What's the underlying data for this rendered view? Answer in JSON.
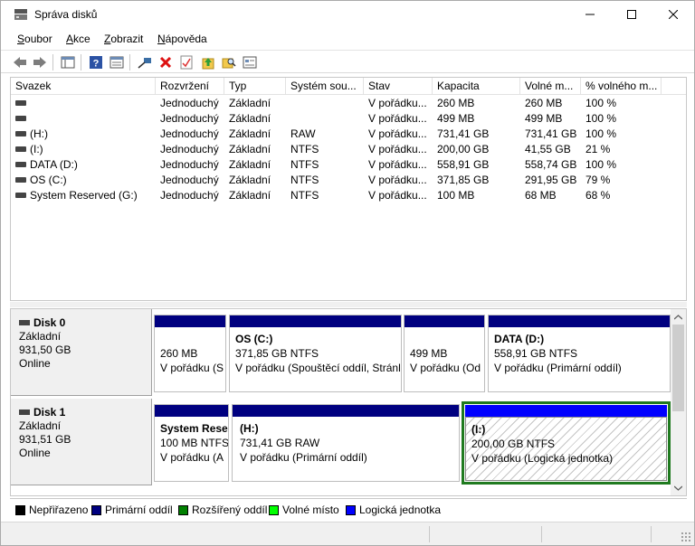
{
  "window": {
    "title": "Správa disků"
  },
  "menu": [
    {
      "label": "Soubor",
      "hot": "S",
      "rest": "oubor"
    },
    {
      "label": "Akce",
      "hot": "A",
      "rest": "kce"
    },
    {
      "label": "Zobrazit",
      "hot": "Z",
      "rest": "obrazit"
    },
    {
      "label": "Nápověda",
      "hot": "N",
      "rest": "ápověda"
    }
  ],
  "volume_list": {
    "columns": [
      "Svazek",
      "Rozvržení",
      "Typ",
      "Systém sou...",
      "Stav",
      "Kapacita",
      "Volné m...",
      "% volného m..."
    ],
    "rows": [
      {
        "svazek": "",
        "rozvrzeni": "Jednoduchý",
        "typ": "Základní",
        "system": "",
        "stav": "V pořádku...",
        "kapacita": "260 MB",
        "volne": "260 MB",
        "procento": "100 %"
      },
      {
        "svazek": "",
        "rozvrzeni": "Jednoduchý",
        "typ": "Základní",
        "system": "",
        "stav": "V pořádku...",
        "kapacita": "499 MB",
        "volne": "499 MB",
        "procento": "100 %"
      },
      {
        "svazek": "(H:)",
        "rozvrzeni": "Jednoduchý",
        "typ": "Základní",
        "system": "RAW",
        "stav": "V pořádku...",
        "kapacita": "731,41 GB",
        "volne": "731,41 GB",
        "procento": "100 %"
      },
      {
        "svazek": "(I:)",
        "rozvrzeni": "Jednoduchý",
        "typ": "Základní",
        "system": "NTFS",
        "stav": "V pořádku...",
        "kapacita": "200,00 GB",
        "volne": "41,55 GB",
        "procento": "21 %"
      },
      {
        "svazek": "DATA (D:)",
        "rozvrzeni": "Jednoduchý",
        "typ": "Základní",
        "system": "NTFS",
        "stav": "V pořádku...",
        "kapacita": "558,91 GB",
        "volne": "558,74 GB",
        "procento": "100 %"
      },
      {
        "svazek": "OS (C:)",
        "rozvrzeni": "Jednoduchý",
        "typ": "Základní",
        "system": "NTFS",
        "stav": "V pořádku...",
        "kapacita": "371,85 GB",
        "volne": "291,95 GB",
        "procento": "79 %"
      },
      {
        "svazek": "System Reserved (G:)",
        "rozvrzeni": "Jednoduchý",
        "typ": "Základní",
        "system": "NTFS",
        "stav": "V pořádku...",
        "kapacita": "100 MB",
        "volne": "68 MB",
        "procento": "68 %"
      }
    ]
  },
  "disks": [
    {
      "name": "Disk 0",
      "type": "Základní",
      "size": "931,50 GB",
      "status": "Online",
      "partitions": [
        {
          "name": "",
          "size": "260 MB",
          "status": "V pořádku (S"
        },
        {
          "name": "OS  (C:)",
          "size": "371,85 GB NTFS",
          "status": "V pořádku (Spouštěcí oddíl, Stránl"
        },
        {
          "name": "",
          "size": "499 MB",
          "status": "V pořádku (Od"
        },
        {
          "name": "DATA  (D:)",
          "size": "558,91 GB NTFS",
          "status": "V pořádku (Primární oddíl)"
        }
      ]
    },
    {
      "name": "Disk 1",
      "type": "Základní",
      "size": "931,51 GB",
      "status": "Online",
      "partitions": [
        {
          "name": "System Rese",
          "size": "100 MB NTFS",
          "status": "V pořádku (A"
        },
        {
          "name": "(H:)",
          "size": "731,41 GB RAW",
          "status": "V pořádku (Primární oddíl)"
        },
        {
          "name": "(I:)",
          "size": "200,00 GB NTFS",
          "status": "V pořádku (Logická jednotka)"
        }
      ]
    }
  ],
  "legend": [
    {
      "label": "Nepřiřazeno",
      "color": "#000000"
    },
    {
      "label": "Primární oddíl",
      "color": "#000080"
    },
    {
      "label": "Rozšířený oddíl",
      "color": "#008000"
    },
    {
      "label": "Volné místo",
      "color": "#00ff00"
    },
    {
      "label": "Logická jednotka",
      "color": "#0000ff"
    }
  ],
  "colors": {
    "primary_bar": "#000080",
    "logical_bar": "#0000ff",
    "extended_frame": "#1f7a1f"
  },
  "toolbar_icons": [
    "back-arrow-icon",
    "forward-arrow-icon",
    "console-tree-icon",
    "help-icon",
    "properties-icon",
    "connect-icon",
    "delete-icon",
    "check-icon",
    "folder-up-icon",
    "search-folder-icon",
    "list-view-icon"
  ]
}
